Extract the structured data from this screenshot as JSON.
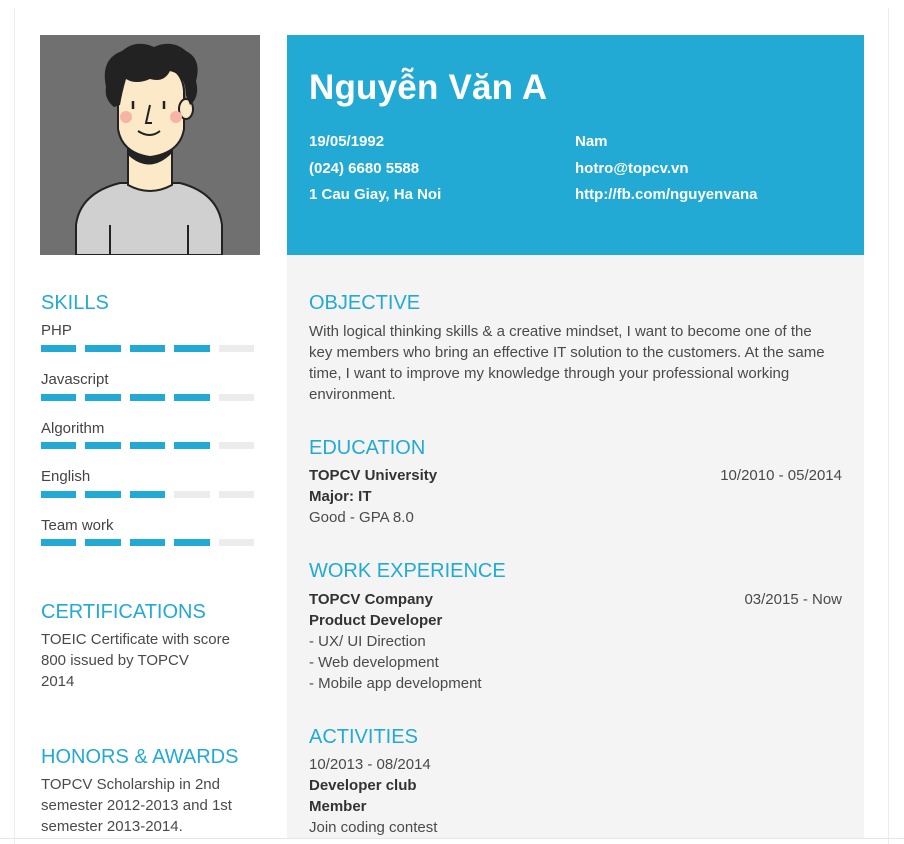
{
  "header": {
    "name": "Nguyễn Văn A",
    "dob": "19/05/1992",
    "gender": "Nam",
    "phone": "(024) 6680 5588",
    "email": "hotro@topcv.vn",
    "address": "1 Cau Giay, Ha Noi",
    "website": "http://fb.com/nguyenvana"
  },
  "colors": {
    "accent": "#22aad4",
    "sidebar_bg": "#ffffff",
    "main_bg": "#f4f4f4",
    "avatar_bg": "#6f706f"
  },
  "sidebar": {
    "skills_title": "SKILLS",
    "skills": [
      {
        "label": "PHP",
        "level": 4,
        "max": 5
      },
      {
        "label": "Javascript",
        "level": 4,
        "max": 5
      },
      {
        "label": "Algorithm",
        "level": 4,
        "max": 5
      },
      {
        "label": "English",
        "level": 3,
        "max": 5
      },
      {
        "label": "Team work",
        "level": 4,
        "max": 5
      }
    ],
    "certifications_title": "CERTIFICATIONS",
    "certifications_lines": [
      "TOEIC Certificate with score",
      "800 issued by TOPCV",
      "2014"
    ],
    "awards_title": "HONORS & AWARDS",
    "awards_lines": [
      "TOPCV Scholarship in 2nd",
      "semester 2012-2013 and 1st",
      "semester 2013-2014."
    ]
  },
  "main": {
    "objective_title": "OBJECTIVE",
    "objective_lines": [
      "With logical thinking skills & a creative mindset, I want to become one of the",
      "key members who bring an effective IT solution to the customers. At the same",
      "time, I want to improve my knowledge through your professional working",
      "environment."
    ],
    "education_title": "EDUCATION",
    "education": {
      "school": "TOPCV University",
      "period": "10/2010 - 05/2014",
      "major": "Major: IT",
      "gpa": "Good - GPA 8.0"
    },
    "work_title": "WORK EXPERIENCE",
    "work": {
      "company": "TOPCV Company",
      "period": "03/2015 - Now",
      "role": "Product Developer",
      "tasks": [
        "- UX/ UI Direction",
        "- Web development",
        "- Mobile app development"
      ]
    },
    "activities_title": "ACTIVITIES",
    "activities": {
      "period": "10/2013 - 08/2014",
      "org": "Developer club",
      "role": "Member",
      "desc": "Join coding contest"
    }
  }
}
